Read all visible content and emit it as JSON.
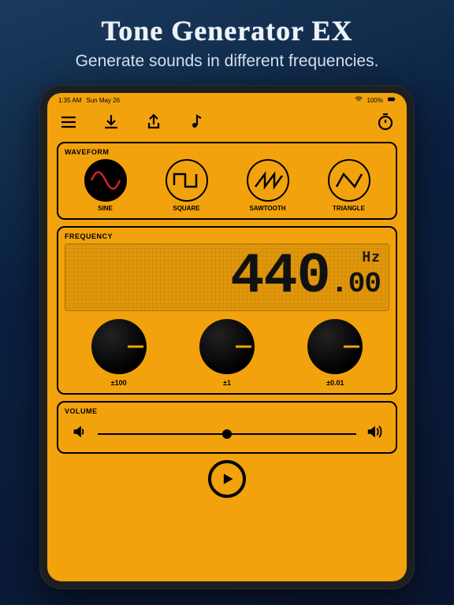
{
  "promo": {
    "title": "Tone Generator EX",
    "subtitle": "Generate sounds in different frequencies."
  },
  "status": {
    "time": "1:35 AM",
    "date": "Sun May 26",
    "battery": "100%"
  },
  "panels": {
    "waveform_title": "WAVEFORM",
    "frequency_title": "FREQUENCY",
    "volume_title": "VOLUME"
  },
  "waveforms": [
    {
      "key": "sine",
      "label": "SINE",
      "selected": true
    },
    {
      "key": "square",
      "label": "SQUARE",
      "selected": false
    },
    {
      "key": "sawtooth",
      "label": "SAWTOOTH",
      "selected": false
    },
    {
      "key": "triangle",
      "label": "TRIANGLE",
      "selected": false
    }
  ],
  "frequency": {
    "unit": "Hz",
    "int": "440",
    "dot": ".",
    "frac": "00",
    "value": 440.0
  },
  "knobs": [
    {
      "label": "±100"
    },
    {
      "label": "±1"
    },
    {
      "label": "±0.01"
    }
  ],
  "volume": {
    "value": 0.5
  },
  "colors": {
    "accent": "#f2a20c"
  }
}
